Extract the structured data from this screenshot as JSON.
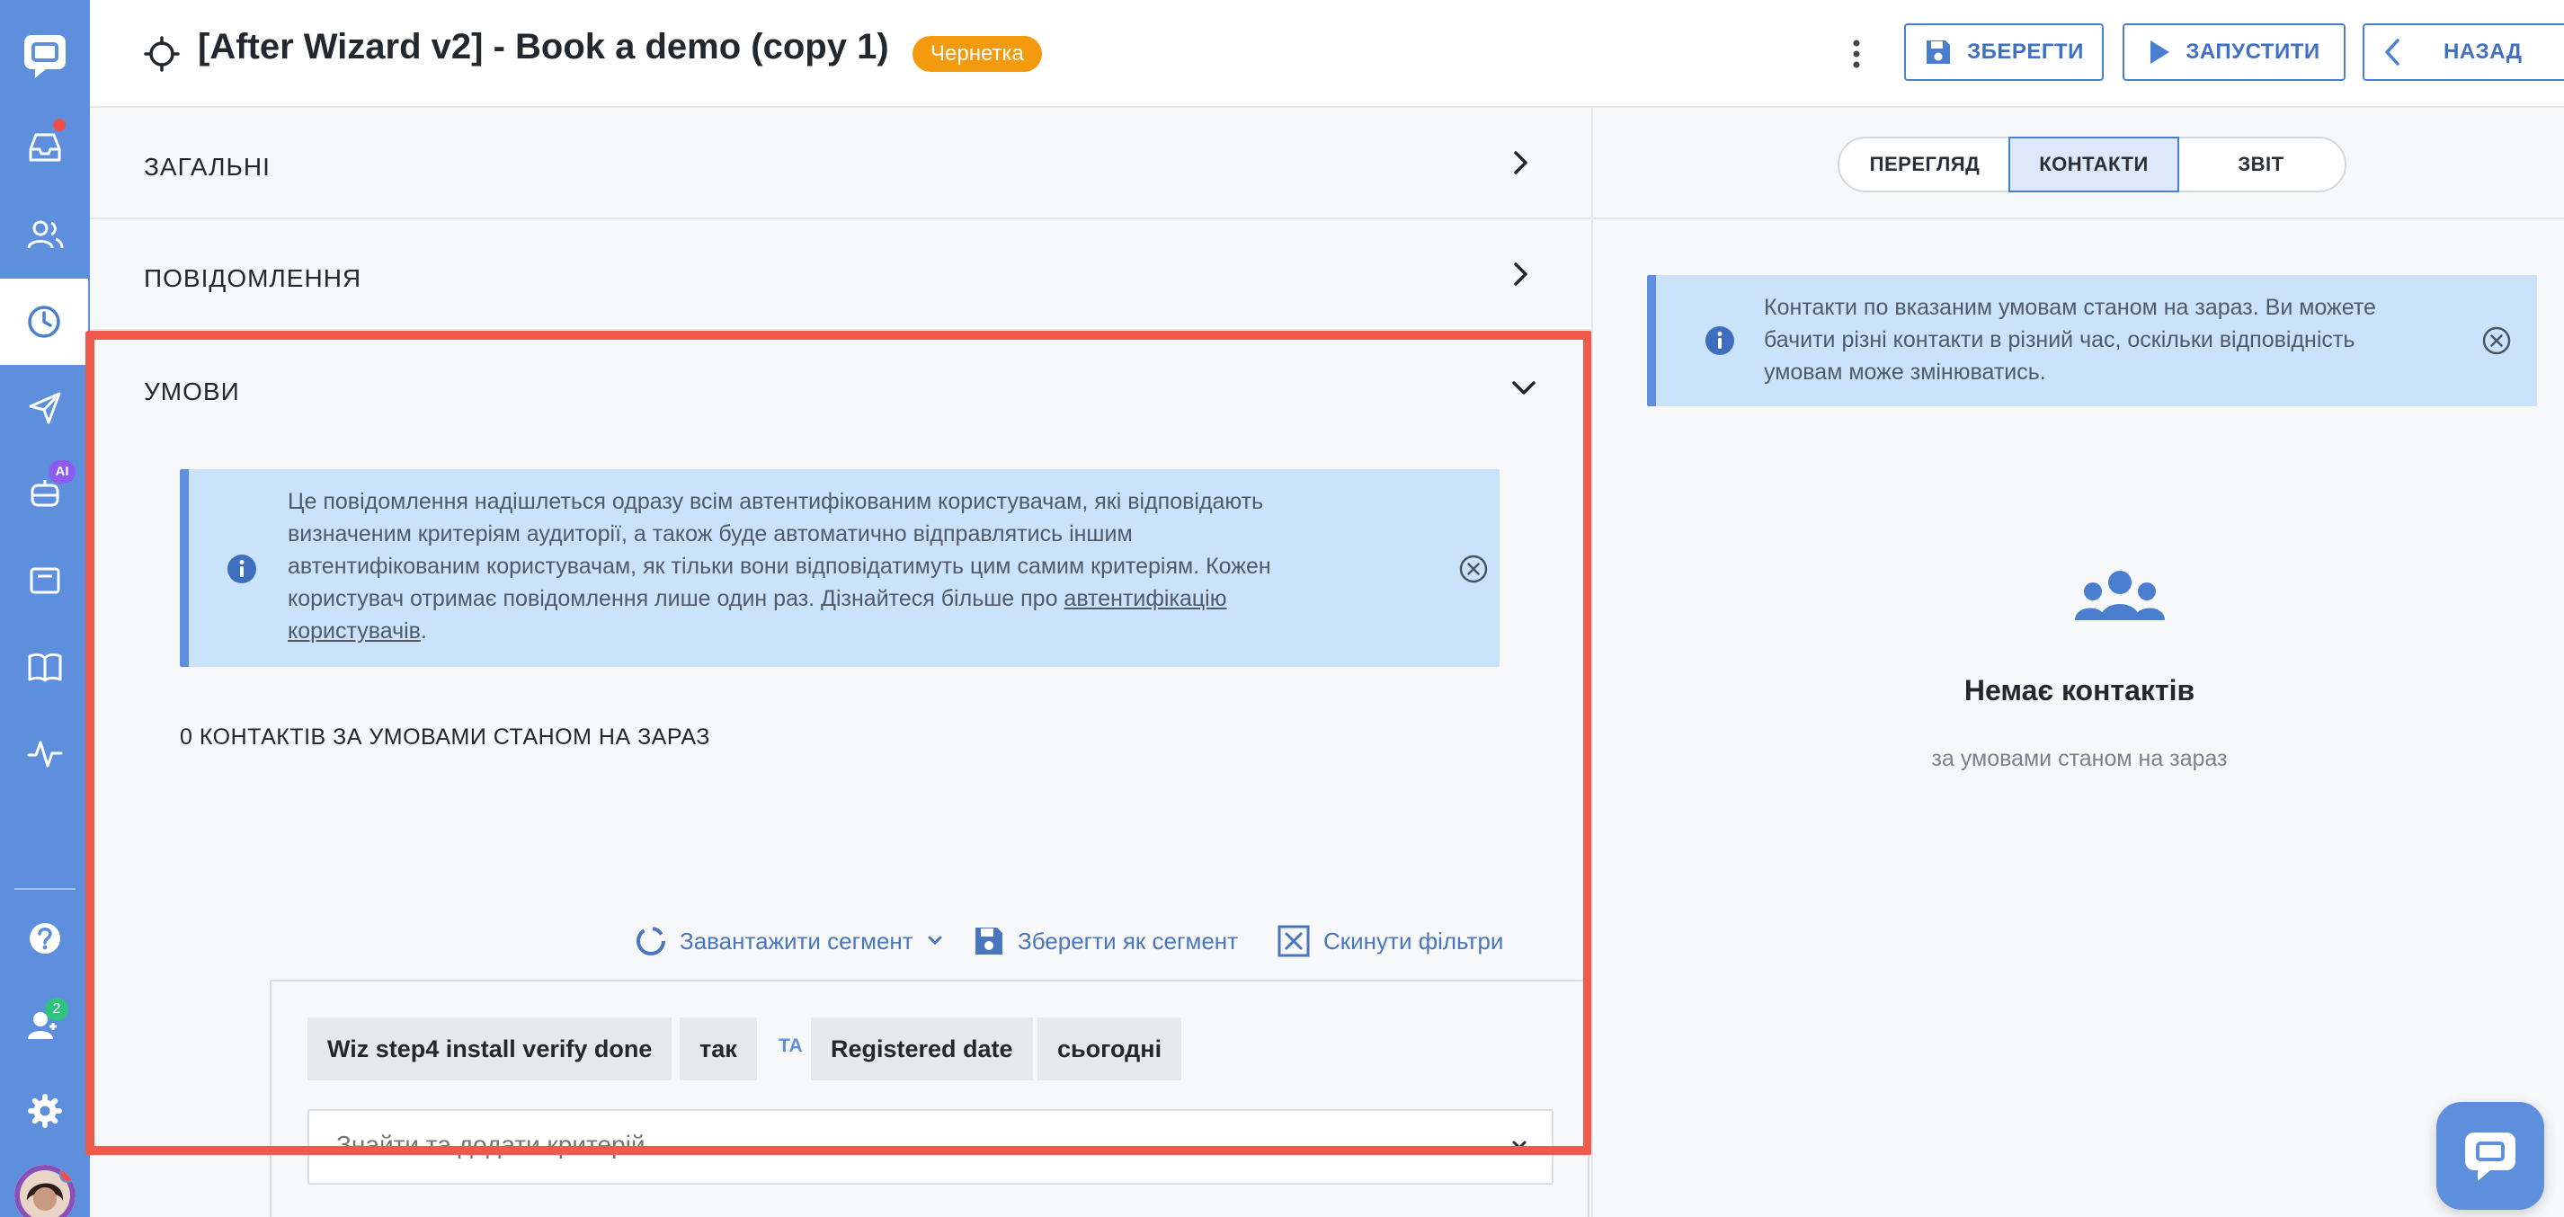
{
  "header": {
    "title": "[After Wizard v2] - Book a demo (copy 1)",
    "status_badge": "Чернетка",
    "save_label": "ЗБЕРЕГТИ",
    "run_label": "ЗАПУСТИТИ",
    "back_label": "НАЗАД"
  },
  "sidebar": {
    "items": [
      {
        "name": "chat-logo",
        "icon": "chat-bubble-icon"
      },
      {
        "name": "inbox",
        "icon": "inbox-icon",
        "has_dot": true
      },
      {
        "name": "contacts",
        "icon": "users-icon"
      },
      {
        "name": "automation",
        "icon": "clock-icon",
        "active": true
      },
      {
        "name": "campaigns",
        "icon": "send-icon"
      },
      {
        "name": "ai-bot",
        "icon": "bot-icon",
        "badge": "AI"
      },
      {
        "name": "widget",
        "icon": "window-icon"
      },
      {
        "name": "knowledge-base",
        "icon": "book-icon"
      },
      {
        "name": "analytics",
        "icon": "pulse-icon"
      },
      {
        "name": "help",
        "icon": "question-icon"
      },
      {
        "name": "team",
        "icon": "team-icon",
        "badge": "2"
      },
      {
        "name": "settings",
        "icon": "gear-icon"
      },
      {
        "name": "avatar",
        "icon": "avatar",
        "has_dot": true
      }
    ]
  },
  "sections": {
    "general": "ЗАГАЛЬНІ",
    "messages": "ПОВІДОМЛЕННЯ",
    "conditions": "УМОВИ"
  },
  "conditions": {
    "info_line1": "Це повідомлення надішлеться одразу всім автентифікованим користувачам, які відповідають",
    "info_line2": "визначеним критеріям аудиторії, а також буде автоматично відправлятись іншим",
    "info_line3": "автентифікованим користувачам, як тільки вони відповідатимуть цим самим критеріям. Кожен",
    "info_line4_pre": "користувач отримає повідомлення лише один раз. Дізнайтеся більше про ",
    "info_link_part1": "автентифікацію",
    "info_link_part2": "користувачів",
    "info_line5_post": ".",
    "count_label": "0 КОНТАКТІВ ЗА УМОВАМИ СТАНОМ НА ЗАРАЗ",
    "load_segment": "Завантажити сегмент",
    "save_segment": "Зберегти як сегмент",
    "reset_filters": "Скинути фільтри",
    "filters": {
      "chip1": "Wiz step4 install verify done",
      "chip2": "так",
      "connector": "ТА",
      "chip3": "Registered date",
      "chip4": "сьогодні"
    },
    "search_placeholder": "Знайти та додати критерій..."
  },
  "right_panel": {
    "tabs": [
      "ПЕРЕГЛЯД",
      "КОНТАКТИ",
      "ЗВІТ"
    ],
    "selected_tab": "КОНТАКТИ",
    "info_line1": "Контакти по вказаним умовам станом на зараз. Ви можете",
    "info_line2": "бачити різні контакти в різний час, оскільки відповідність",
    "info_line3": "умовам може змінюватись.",
    "empty_title": "Немає контактів",
    "empty_subtitle": "за умовами станом на зараз"
  },
  "colors": {
    "sidebar": "#5d8fdd",
    "accent": "#4a7fd0",
    "draft_badge": "#f39a0f",
    "highlight_border": "#f05a4c",
    "info_bg": "#cbe2fb"
  }
}
